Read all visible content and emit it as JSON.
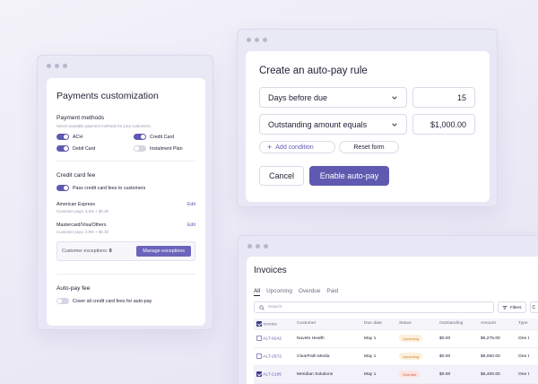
{
  "payments": {
    "title": "Payments customization",
    "methods_heading": "Payment methods",
    "methods_sub": "Select available payment methods for your customers.",
    "methods": [
      {
        "label": "ACH",
        "on": true
      },
      {
        "label": "Credit Card",
        "on": true
      },
      {
        "label": "Debit Card",
        "on": true
      },
      {
        "label": "Instalment Plan",
        "on": false
      }
    ],
    "cc_heading": "Credit card fee",
    "pass_fees_label": "Pass credit card fees to customers",
    "cards": [
      {
        "name": "American Express",
        "fee": "Customer pays: 3.5% + $0.30",
        "edit": "Edit"
      },
      {
        "name": "Mastercard/Visa/Others",
        "fee": "Customer pays: 2.9% + $0.30",
        "edit": "Edit"
      }
    ],
    "exceptions_label": "Customer exceptions:",
    "exceptions_count": "0",
    "manage_button": "Manage exceptions",
    "autopay_heading": "Auto-pay fee",
    "autopay_toggle_label": "Cover all credit card fees for auto-pay"
  },
  "rule": {
    "title": "Create an auto-pay rule",
    "select1": "Days before due",
    "value1": "15",
    "select2": "Outstanding amount equals",
    "value2": "$1,000.00",
    "add_condition": "Add condition",
    "reset": "Reset form",
    "cancel": "Cancel",
    "submit": "Enable auto-pay"
  },
  "invoices": {
    "title": "Invoices",
    "tabs": [
      "All",
      "Upcoming",
      "Overdue",
      "Paid"
    ],
    "search_placeholder": "Search",
    "filters": "Filters",
    "columns": [
      "Invoice",
      "Customer",
      "Due date",
      "Status",
      "Outstanding",
      "Amount",
      "Type"
    ],
    "rows": [
      {
        "id": "ALT-9242",
        "customer": "Nuvelo Health",
        "due": "May 1",
        "status": "Upcoming",
        "outstanding": "$0.00",
        "amount": "$5,275.00",
        "type": "One t",
        "checked": false
      },
      {
        "id": "ALT-2572",
        "customer": "ClearPath Media",
        "due": "May 1",
        "status": "Upcoming",
        "outstanding": "$0.00",
        "amount": "$8,050.00",
        "type": "One t",
        "checked": false
      },
      {
        "id": "ALT-2185",
        "customer": "Meridian Solutions",
        "due": "May 1",
        "status": "Overdue",
        "outstanding": "$0.00",
        "amount": "$5,400.00",
        "type": "One t",
        "checked": true
      }
    ]
  }
}
